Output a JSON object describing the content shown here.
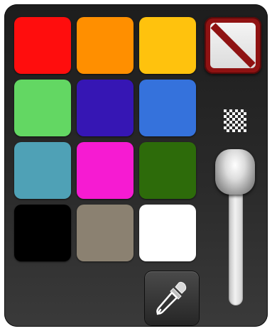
{
  "swatches": [
    {
      "name": "red",
      "color": "#ff0d0d"
    },
    {
      "name": "orange",
      "color": "#ff8f00"
    },
    {
      "name": "yellow",
      "color": "#ffc20d"
    },
    {
      "name": "green",
      "color": "#63d763"
    },
    {
      "name": "indigo",
      "color": "#3616b4"
    },
    {
      "name": "blue",
      "color": "#3572dc"
    },
    {
      "name": "teal",
      "color": "#4fa1b6"
    },
    {
      "name": "magenta",
      "color": "#f61bd2"
    },
    {
      "name": "dark-green",
      "color": "#2d6b0a"
    },
    {
      "name": "black",
      "color": "#000000"
    },
    {
      "name": "taupe",
      "color": "#8b8171"
    },
    {
      "name": "white",
      "color": "#ffffff"
    }
  ],
  "none_swatch": {
    "selected": true,
    "border_color": "#8f1212",
    "slash_color": "#8f1212"
  },
  "transparency_icon": "checkerboard-icon",
  "opacity_slider": {
    "value": 1.0
  },
  "eyedropper_icon": "eyedropper-icon"
}
